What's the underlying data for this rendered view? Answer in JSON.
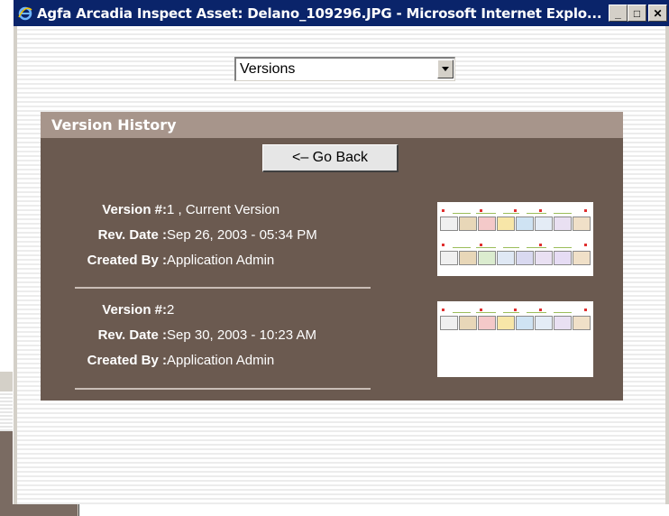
{
  "window": {
    "title": "Agfa Arcadia Inspect Asset: Delano_109296.JPG - Microsoft Internet Explo...",
    "minimize": "_",
    "maximize": "□",
    "close": "✕"
  },
  "view_select": {
    "value": "Versions"
  },
  "panel": {
    "heading": "Version History",
    "back_button": "<– Go Back"
  },
  "labels": {
    "version": "Version #:",
    "rev_date": "Rev. Date :",
    "created_by": "Created By :"
  },
  "versions": [
    {
      "number": "1 , Current Version",
      "rev_date": "Sep 26, 2003 - 05:34 PM",
      "created_by": "Application Admin"
    },
    {
      "number": "2",
      "rev_date": "Sep 30, 2003 - 10:23 AM",
      "created_by": "Application Admin"
    }
  ],
  "background_window": {
    "buttons": [
      "_",
      "□",
      "✕"
    ]
  },
  "colors": {
    "titlebar": "#0a246a",
    "panel": "#6b5a50",
    "panel_header": "#a7958b"
  }
}
